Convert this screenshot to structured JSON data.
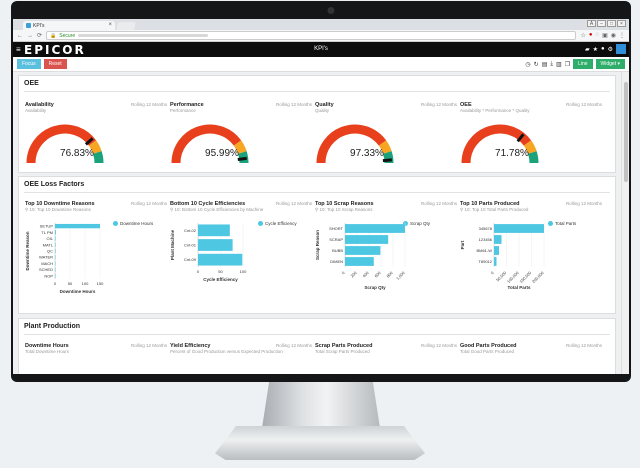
{
  "browser": {
    "tab_title": "KPI's",
    "addr_secure": "Secure"
  },
  "app": {
    "logo": "EPICOR",
    "page_title": "KPI's"
  },
  "toolbar": {
    "focus": "Focus",
    "reset": "Reset",
    "line": "Line",
    "widget": "Widget ▾"
  },
  "oee_section": {
    "title": "OEE"
  },
  "gauges": [
    {
      "title": "Availability",
      "subtitle": "Availability",
      "rolling": "Rolling 12 Months",
      "value": "76.83%",
      "pct": 76.83
    },
    {
      "title": "Performance",
      "subtitle": "Performance",
      "rolling": "Rolling 12 Months",
      "value": "95.99%",
      "pct": 95.99
    },
    {
      "title": "Quality",
      "subtitle": "Quality",
      "rolling": "Rolling 12 Months",
      "value": "97.33%",
      "pct": 97.33
    },
    {
      "title": "OEE",
      "subtitle": "Availability * Performance * Quality",
      "rolling": "Rolling 12 Months",
      "value": "71.78%",
      "pct": 71.78
    }
  ],
  "loss_section": {
    "title": "OEE Loss Factors"
  },
  "chart_data": [
    {
      "type": "bar",
      "title": "Top 10 Downtime Reasons",
      "subtitle": "10: Top 10 Downtime Reasons",
      "rolling": "Rolling 12 Months",
      "orientation": "horizontal",
      "categories": [
        "SETUP",
        "TL PM",
        "OIL",
        "MATL",
        "QC",
        "WATER",
        "MACH",
        "SCHED",
        "NOP"
      ],
      "values": [
        150,
        3,
        2,
        2,
        2,
        1,
        1,
        1,
        1
      ],
      "xlim": [
        0,
        150
      ],
      "ticks": [
        "0",
        "50",
        "100",
        "150"
      ],
      "xlabel": "Downtime Hours",
      "ylabel": "Downtime Reason",
      "legend": "Downtime Hours"
    },
    {
      "type": "bar",
      "title": "Bottom 10 Cycle Efficiencies",
      "subtitle": "10: Bottom 10 Cycle Efficiencies by Machine",
      "rolling": "Rolling 12 Months",
      "orientation": "horizontal",
      "categories": [
        "Cnt-02",
        "Cnt-01",
        "Cnt-09"
      ],
      "values": [
        92,
        100,
        128
      ],
      "xlim": [
        0,
        130
      ],
      "ticks": [
        "0",
        "50",
        "100"
      ],
      "xlabel": "Cycle Efficiency",
      "ylabel": "Plant Machine",
      "legend": "Cycle Efficiency"
    },
    {
      "type": "bar",
      "title": "Top 10 Scrap Reasons",
      "subtitle": "10: Top 10 Scrap Reasons",
      "rolling": "Rolling 12 Months",
      "orientation": "horizontal",
      "categories": [
        "SHORT",
        "SCRAP",
        "BUBB",
        "DIMEN"
      ],
      "values": [
        1000,
        720,
        590,
        480
      ],
      "xlim": [
        0,
        1000
      ],
      "ticks": [
        "0",
        "200",
        "400",
        "600",
        "800",
        "1,000"
      ],
      "xlabel": "Scrap Qty",
      "ylabel": "Scrap Reason",
      "legend": "Scrap Qty"
    },
    {
      "type": "bar",
      "title": "Top 10 Parts Produced",
      "subtitle": "10: Top 10 Total Parts Produced",
      "rolling": "Rolling 12 Months",
      "orientation": "horizontal",
      "categories": [
        "345678",
        "123456",
        "BM61-W",
        "T89012"
      ],
      "values": [
        200000,
        30000,
        20000,
        10000
      ],
      "xlim": [
        0,
        200000
      ],
      "ticks": [
        "0",
        "50,000",
        "100,000",
        "150,000",
        "200,000"
      ],
      "xlabel": "Total Parts",
      "ylabel": "Part",
      "legend": "Total Parts"
    }
  ],
  "production_section": {
    "title": "Plant Production"
  },
  "production": [
    {
      "title": "Downtime Hours",
      "subtitle": "Total Downtime Hours",
      "rolling": "Rolling 12 Months"
    },
    {
      "title": "Yield Efficiency",
      "subtitle": "Percent of Good Production versus Expected Production",
      "rolling": "Rolling 12 Months"
    },
    {
      "title": "Scrap Parts Produced",
      "subtitle": "Total Scrap Parts Produced",
      "rolling": "Rolling 12 Months"
    },
    {
      "title": "Good Parts Produced",
      "subtitle": "Total Good Parts Produced",
      "rolling": "Rolling 12 Months"
    }
  ],
  "colors": {
    "bar": "#4ec7e3",
    "gauge_red": "#e8401c",
    "gauge_orange": "#f6a623",
    "gauge_green": "#1aa37a"
  }
}
